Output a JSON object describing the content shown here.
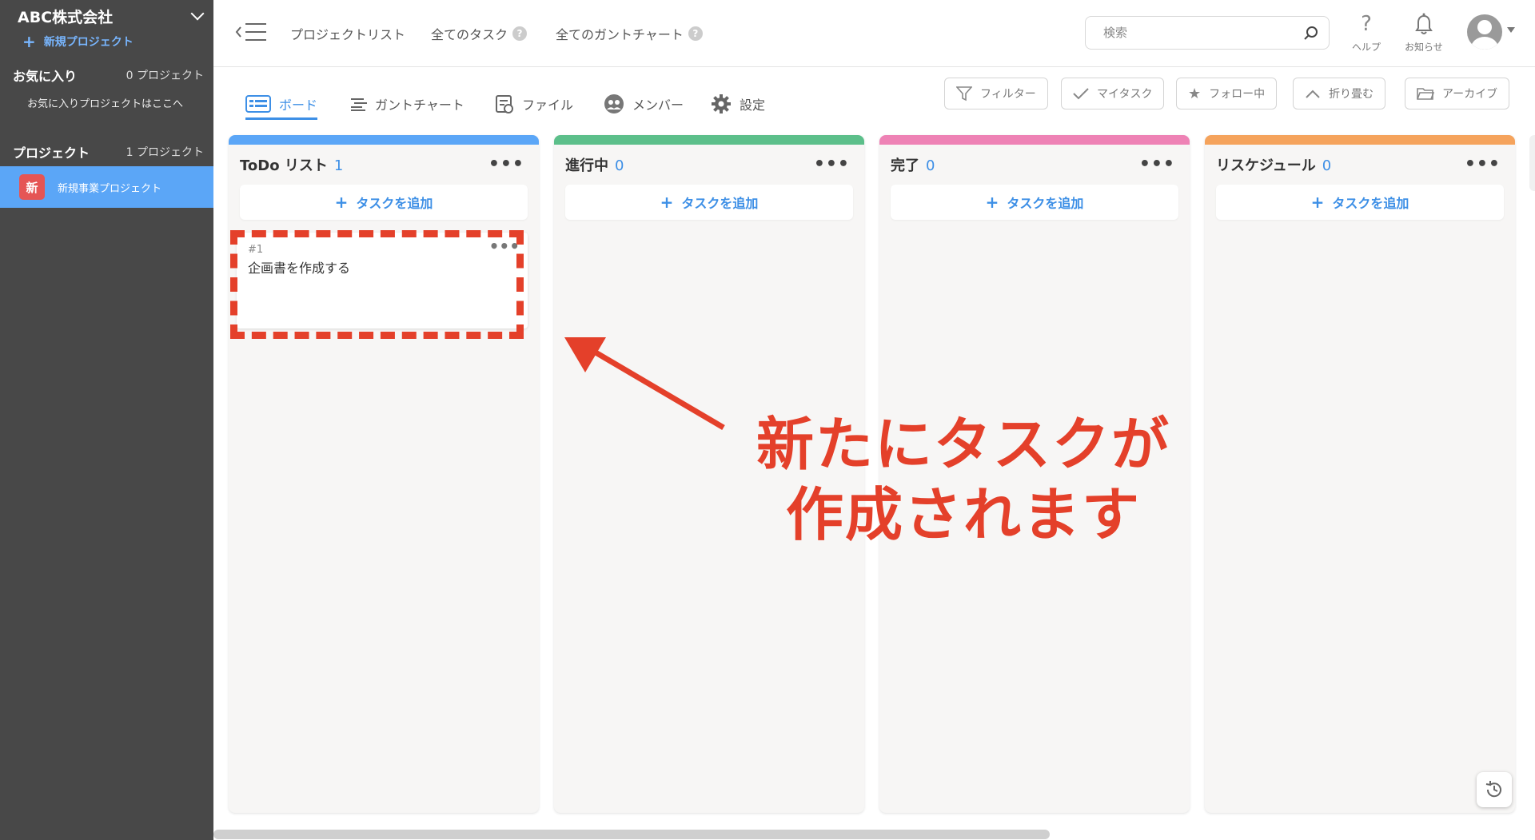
{
  "sidebar": {
    "org_name": "ABC株式会社",
    "new_project": "新規プロジェクト",
    "favorites": {
      "title": "お気に入り",
      "count": "0 プロジェクト",
      "empty": "お気に入りプロジェクトはここへ"
    },
    "projects": {
      "title": "プロジェクト",
      "count": "1 プロジェクト"
    },
    "project_items": [
      {
        "badge": "新",
        "name": "新規事業プロジェクト"
      }
    ]
  },
  "topbar": {
    "nav": [
      "プロジェクトリスト",
      "全てのタスク",
      "全てのガントチャート"
    ],
    "help_mark": "?",
    "search_placeholder": "検索",
    "help_label": "ヘルプ",
    "notify_label": "お知らせ"
  },
  "tabs": [
    "ボード",
    "ガントチャート",
    "ファイル",
    "メンバー",
    "設定"
  ],
  "filters": [
    "フィルター",
    "マイタスク",
    "フォロー中",
    "折り畳む",
    "アーカイブ"
  ],
  "board": {
    "add_task_label": "タスクを追加",
    "columns": [
      {
        "title": "ToDo リスト",
        "count": "1",
        "color": "#5ba6f7"
      },
      {
        "title": "進行中",
        "count": "0",
        "color": "#5cbf8a"
      },
      {
        "title": "完了",
        "count": "0",
        "color": "#ee82b5"
      },
      {
        "title": "リスケジュール",
        "count": "0",
        "color": "#f5a35c"
      }
    ],
    "cards": [
      {
        "id": "#1",
        "title": "企画書を作成する"
      }
    ]
  },
  "annotation": {
    "line1": "新たにタスクが",
    "line2": "作成されます"
  }
}
